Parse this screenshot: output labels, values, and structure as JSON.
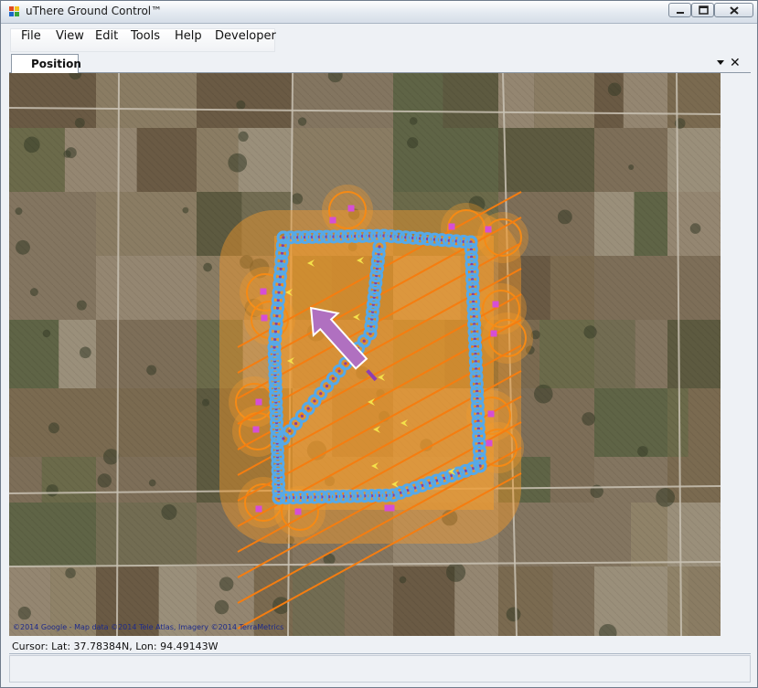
{
  "window": {
    "title": "uThere Ground Control™"
  },
  "menu": {
    "items": [
      {
        "label": "File"
      },
      {
        "label": "View"
      },
      {
        "label": "Edit"
      },
      {
        "label": "Tools"
      },
      {
        "label": "Help"
      },
      {
        "label": "Developer"
      }
    ]
  },
  "tabs": [
    {
      "label": "Position",
      "active": true
    }
  ],
  "map": {
    "copyright": "©2014 Google - Map data ©2014 Tele Atlas, Imagery ©2014 TerraMetrics",
    "colors": {
      "flight_area": "#f39a2b",
      "track": "#56a9e8",
      "waypoint": "#d64ed6",
      "heading_arrow": "#b070c0",
      "direction_marker": "#f5e14a"
    },
    "icons": [
      "vehicle-heading-arrow-icon",
      "waypoint-marker-icon",
      "direction-chevron-icon"
    ]
  },
  "status": {
    "cursor": "Cursor: Lat: 37.78384N, Lon: 94.49143W"
  }
}
